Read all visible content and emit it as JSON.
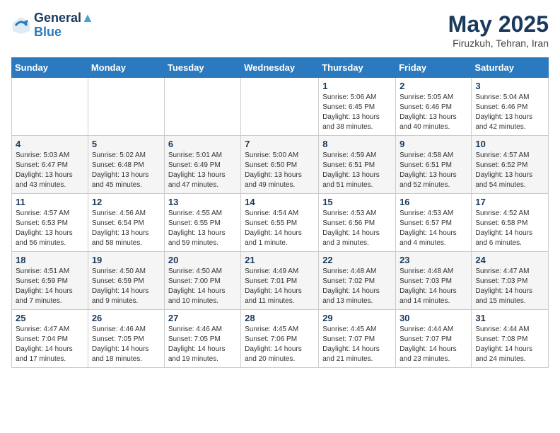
{
  "logo": {
    "line1": "General",
    "line2": "Blue"
  },
  "title": "May 2025",
  "location": "Firuzkuh, Tehran, Iran",
  "headers": [
    "Sunday",
    "Monday",
    "Tuesday",
    "Wednesday",
    "Thursday",
    "Friday",
    "Saturday"
  ],
  "weeks": [
    [
      {
        "day": "",
        "sunrise": "",
        "sunset": "",
        "daylight": ""
      },
      {
        "day": "",
        "sunrise": "",
        "sunset": "",
        "daylight": ""
      },
      {
        "day": "",
        "sunrise": "",
        "sunset": "",
        "daylight": ""
      },
      {
        "day": "",
        "sunrise": "",
        "sunset": "",
        "daylight": ""
      },
      {
        "day": "1",
        "sunrise": "Sunrise: 5:06 AM",
        "sunset": "Sunset: 6:45 PM",
        "daylight": "Daylight: 13 hours and 38 minutes."
      },
      {
        "day": "2",
        "sunrise": "Sunrise: 5:05 AM",
        "sunset": "Sunset: 6:46 PM",
        "daylight": "Daylight: 13 hours and 40 minutes."
      },
      {
        "day": "3",
        "sunrise": "Sunrise: 5:04 AM",
        "sunset": "Sunset: 6:46 PM",
        "daylight": "Daylight: 13 hours and 42 minutes."
      }
    ],
    [
      {
        "day": "4",
        "sunrise": "Sunrise: 5:03 AM",
        "sunset": "Sunset: 6:47 PM",
        "daylight": "Daylight: 13 hours and 43 minutes."
      },
      {
        "day": "5",
        "sunrise": "Sunrise: 5:02 AM",
        "sunset": "Sunset: 6:48 PM",
        "daylight": "Daylight: 13 hours and 45 minutes."
      },
      {
        "day": "6",
        "sunrise": "Sunrise: 5:01 AM",
        "sunset": "Sunset: 6:49 PM",
        "daylight": "Daylight: 13 hours and 47 minutes."
      },
      {
        "day": "7",
        "sunrise": "Sunrise: 5:00 AM",
        "sunset": "Sunset: 6:50 PM",
        "daylight": "Daylight: 13 hours and 49 minutes."
      },
      {
        "day": "8",
        "sunrise": "Sunrise: 4:59 AM",
        "sunset": "Sunset: 6:51 PM",
        "daylight": "Daylight: 13 hours and 51 minutes."
      },
      {
        "day": "9",
        "sunrise": "Sunrise: 4:58 AM",
        "sunset": "Sunset: 6:51 PM",
        "daylight": "Daylight: 13 hours and 52 minutes."
      },
      {
        "day": "10",
        "sunrise": "Sunrise: 4:57 AM",
        "sunset": "Sunset: 6:52 PM",
        "daylight": "Daylight: 13 hours and 54 minutes."
      }
    ],
    [
      {
        "day": "11",
        "sunrise": "Sunrise: 4:57 AM",
        "sunset": "Sunset: 6:53 PM",
        "daylight": "Daylight: 13 hours and 56 minutes."
      },
      {
        "day": "12",
        "sunrise": "Sunrise: 4:56 AM",
        "sunset": "Sunset: 6:54 PM",
        "daylight": "Daylight: 13 hours and 58 minutes."
      },
      {
        "day": "13",
        "sunrise": "Sunrise: 4:55 AM",
        "sunset": "Sunset: 6:55 PM",
        "daylight": "Daylight: 13 hours and 59 minutes."
      },
      {
        "day": "14",
        "sunrise": "Sunrise: 4:54 AM",
        "sunset": "Sunset: 6:55 PM",
        "daylight": "Daylight: 14 hours and 1 minute."
      },
      {
        "day": "15",
        "sunrise": "Sunrise: 4:53 AM",
        "sunset": "Sunset: 6:56 PM",
        "daylight": "Daylight: 14 hours and 3 minutes."
      },
      {
        "day": "16",
        "sunrise": "Sunrise: 4:53 AM",
        "sunset": "Sunset: 6:57 PM",
        "daylight": "Daylight: 14 hours and 4 minutes."
      },
      {
        "day": "17",
        "sunrise": "Sunrise: 4:52 AM",
        "sunset": "Sunset: 6:58 PM",
        "daylight": "Daylight: 14 hours and 6 minutes."
      }
    ],
    [
      {
        "day": "18",
        "sunrise": "Sunrise: 4:51 AM",
        "sunset": "Sunset: 6:59 PM",
        "daylight": "Daylight: 14 hours and 7 minutes."
      },
      {
        "day": "19",
        "sunrise": "Sunrise: 4:50 AM",
        "sunset": "Sunset: 6:59 PM",
        "daylight": "Daylight: 14 hours and 9 minutes."
      },
      {
        "day": "20",
        "sunrise": "Sunrise: 4:50 AM",
        "sunset": "Sunset: 7:00 PM",
        "daylight": "Daylight: 14 hours and 10 minutes."
      },
      {
        "day": "21",
        "sunrise": "Sunrise: 4:49 AM",
        "sunset": "Sunset: 7:01 PM",
        "daylight": "Daylight: 14 hours and 11 minutes."
      },
      {
        "day": "22",
        "sunrise": "Sunrise: 4:48 AM",
        "sunset": "Sunset: 7:02 PM",
        "daylight": "Daylight: 14 hours and 13 minutes."
      },
      {
        "day": "23",
        "sunrise": "Sunrise: 4:48 AM",
        "sunset": "Sunset: 7:03 PM",
        "daylight": "Daylight: 14 hours and 14 minutes."
      },
      {
        "day": "24",
        "sunrise": "Sunrise: 4:47 AM",
        "sunset": "Sunset: 7:03 PM",
        "daylight": "Daylight: 14 hours and 15 minutes."
      }
    ],
    [
      {
        "day": "25",
        "sunrise": "Sunrise: 4:47 AM",
        "sunset": "Sunset: 7:04 PM",
        "daylight": "Daylight: 14 hours and 17 minutes."
      },
      {
        "day": "26",
        "sunrise": "Sunrise: 4:46 AM",
        "sunset": "Sunset: 7:05 PM",
        "daylight": "Daylight: 14 hours and 18 minutes."
      },
      {
        "day": "27",
        "sunrise": "Sunrise: 4:46 AM",
        "sunset": "Sunset: 7:05 PM",
        "daylight": "Daylight: 14 hours and 19 minutes."
      },
      {
        "day": "28",
        "sunrise": "Sunrise: 4:45 AM",
        "sunset": "Sunset: 7:06 PM",
        "daylight": "Daylight: 14 hours and 20 minutes."
      },
      {
        "day": "29",
        "sunrise": "Sunrise: 4:45 AM",
        "sunset": "Sunset: 7:07 PM",
        "daylight": "Daylight: 14 hours and 21 minutes."
      },
      {
        "day": "30",
        "sunrise": "Sunrise: 4:44 AM",
        "sunset": "Sunset: 7:07 PM",
        "daylight": "Daylight: 14 hours and 23 minutes."
      },
      {
        "day": "31",
        "sunrise": "Sunrise: 4:44 AM",
        "sunset": "Sunset: 7:08 PM",
        "daylight": "Daylight: 14 hours and 24 minutes."
      }
    ]
  ]
}
